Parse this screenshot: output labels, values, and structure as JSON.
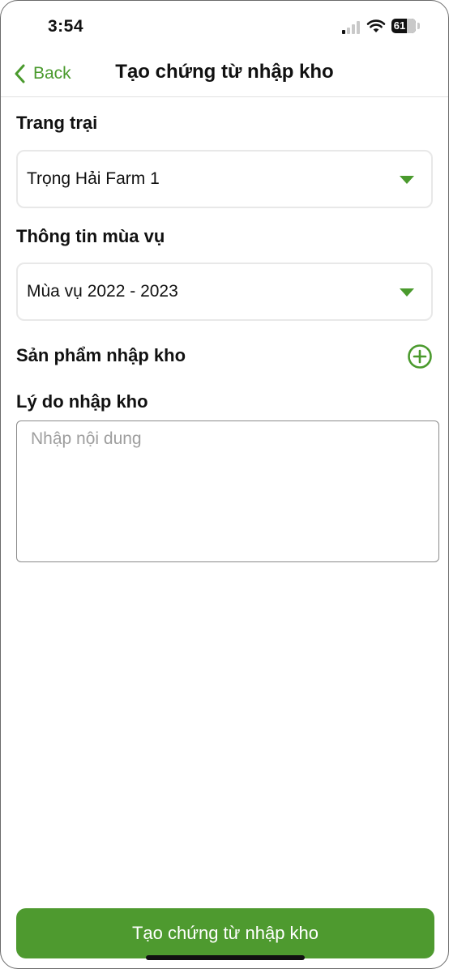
{
  "status_bar": {
    "time": "3:54",
    "battery": "61"
  },
  "nav": {
    "back_label": "Back",
    "title": "Tạo chứng từ nhập kho"
  },
  "form": {
    "farm_label": "Trang trại",
    "farm_value": "Trọng Hải Farm 1",
    "season_label": "Thông tin mùa vụ",
    "season_value": "Mùa vụ 2022 - 2023",
    "products_label": "Sản phẩm nhập kho",
    "reason_label": "Lý do nhập kho",
    "reason_placeholder": "Nhập nội dung",
    "reason_value": ""
  },
  "submit_label": "Tạo chứng từ nhập kho",
  "colors": {
    "accent": "#4a9a2d",
    "button": "#4e9a2f"
  },
  "icons": [
    "signal-icon",
    "wifi-icon",
    "battery-icon",
    "back-chevron-icon",
    "dropdown-caret-icon",
    "add-circle-icon"
  ]
}
